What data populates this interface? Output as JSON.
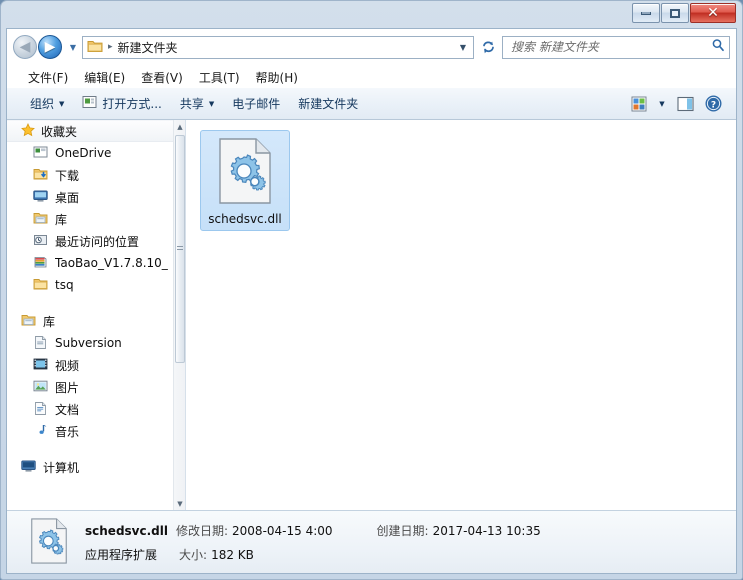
{
  "window": {
    "minimize_label": "最小化",
    "maximize_label": "最大化",
    "close_label": "关闭",
    "close_glyph": "✕"
  },
  "nav": {
    "back_label": "后退",
    "forward_label": "前进",
    "recent_pages_label": "最近浏览的页面",
    "refresh_label": "刷新",
    "address_path": "新建文件夹",
    "address_separator": "▸",
    "address_caret": "▼"
  },
  "search": {
    "placeholder": "搜索 新建文件夹",
    "value": "",
    "icon": "search-icon"
  },
  "menubar": {
    "items": [
      {
        "label": "文件(F)",
        "name": "menu-file"
      },
      {
        "label": "编辑(E)",
        "name": "menu-edit"
      },
      {
        "label": "查看(V)",
        "name": "menu-view"
      },
      {
        "label": "工具(T)",
        "name": "menu-tools"
      },
      {
        "label": "帮助(H)",
        "name": "menu-help"
      }
    ]
  },
  "toolbar": {
    "organize_label": "组织",
    "openwith_label": "打开方式...",
    "share_label": "共享",
    "email_label": "电子邮件",
    "newfolder_label": "新建文件夹",
    "caret": "▼",
    "views_label": "更改您的视图",
    "views_caret": "▼",
    "preview_label": "显示预览窗格",
    "help_label": "获取帮助",
    "help_glyph": "?"
  },
  "sidebar": {
    "favorites": {
      "header": "收藏夹",
      "items": [
        {
          "label": "OneDrive",
          "icon": "onedrive-icon"
        },
        {
          "label": "下载",
          "icon": "downloads-icon"
        },
        {
          "label": "桌面",
          "icon": "desktop-icon"
        },
        {
          "label": "库",
          "icon": "library-icon"
        },
        {
          "label": "最近访问的位置",
          "icon": "recent-places-icon"
        },
        {
          "label": "TaoBao_V1.7.8.10_",
          "icon": "archive-icon"
        },
        {
          "label": "tsq",
          "icon": "folder-icon"
        }
      ]
    },
    "libraries": {
      "header": "库",
      "items": [
        {
          "label": "Subversion",
          "icon": "subversion-icon"
        },
        {
          "label": "视频",
          "icon": "video-icon"
        },
        {
          "label": "图片",
          "icon": "pictures-icon"
        },
        {
          "label": "文档",
          "icon": "documents-icon"
        },
        {
          "label": "音乐",
          "icon": "music-icon"
        }
      ]
    },
    "computer": {
      "label": "计算机",
      "icon": "computer-icon"
    }
  },
  "content": {
    "files": [
      {
        "name": "schedsvc.dll",
        "icon": "dll-gear-icon",
        "selected": true
      }
    ]
  },
  "details": {
    "file_name": "schedsvc.dll",
    "modified_label": "修改日期:",
    "modified_value": "2008-04-15 4:00",
    "created_label": "创建日期:",
    "created_value": "2017-04-13 10:35",
    "type_value": "应用程序扩展",
    "size_label": "大小:",
    "size_value": "182 KB"
  },
  "scrollbar": {
    "up_glyph": "▲",
    "down_glyph": "▼"
  },
  "colors": {
    "frame": "#cbd9e8",
    "selection": "#c6e0f8",
    "accent": "#2f6aa8",
    "close_red": "#bf2d22"
  }
}
